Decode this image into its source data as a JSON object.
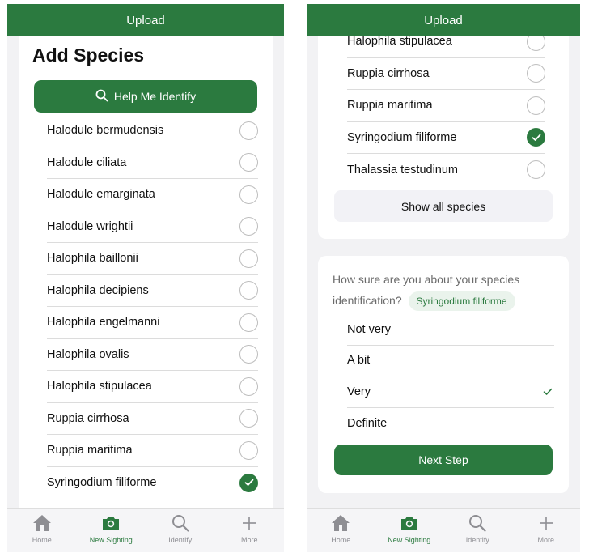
{
  "left": {
    "header": {
      "title": "Upload"
    },
    "page_title": "Add Species",
    "help_button": "Help Me Identify",
    "species": [
      {
        "name": "Halodule bermudensis",
        "selected": false
      },
      {
        "name": "Halodule ciliata",
        "selected": false
      },
      {
        "name": "Halodule emarginata",
        "selected": false
      },
      {
        "name": "Halodule wrightii",
        "selected": false
      },
      {
        "name": "Halophila baillonii",
        "selected": false
      },
      {
        "name": "Halophila decipiens",
        "selected": false
      },
      {
        "name": "Halophila engelmanni",
        "selected": false
      },
      {
        "name": "Halophila ovalis",
        "selected": false
      },
      {
        "name": "Halophila stipulacea",
        "selected": false
      },
      {
        "name": "Ruppia cirrhosa",
        "selected": false
      },
      {
        "name": "Ruppia maritima",
        "selected": false
      },
      {
        "name": "Syringodium filiforme",
        "selected": true
      }
    ]
  },
  "right": {
    "header": {
      "title": "Upload"
    },
    "species": [
      {
        "name": "Halophila stipulacea",
        "selected": false
      },
      {
        "name": "Ruppia cirrhosa",
        "selected": false
      },
      {
        "name": "Ruppia maritima",
        "selected": false
      },
      {
        "name": "Syringodium filiforme",
        "selected": true
      },
      {
        "name": "Thalassia testudinum",
        "selected": false
      }
    ],
    "show_all": "Show all species",
    "confidence": {
      "question": "How sure are you about your species identification?",
      "selected_species": "Syringodium filiforme",
      "options": [
        {
          "label": "Not very",
          "selected": false
        },
        {
          "label": "A bit",
          "selected": false
        },
        {
          "label": "Very",
          "selected": true
        },
        {
          "label": "Definite",
          "selected": false
        }
      ],
      "next_button": "Next Step"
    }
  },
  "tabbar": {
    "tabs": [
      {
        "label": "Home",
        "icon": "home-icon",
        "active": false
      },
      {
        "label": "New Sighting",
        "icon": "camera-icon",
        "active": true
      },
      {
        "label": "Identify",
        "icon": "search-icon",
        "active": false
      },
      {
        "label": "More",
        "icon": "plus-icon",
        "active": false
      }
    ]
  },
  "colors": {
    "accent": "#2b7a3f",
    "background": "#f2f2f4",
    "chip_bg": "#eaf3ec"
  }
}
